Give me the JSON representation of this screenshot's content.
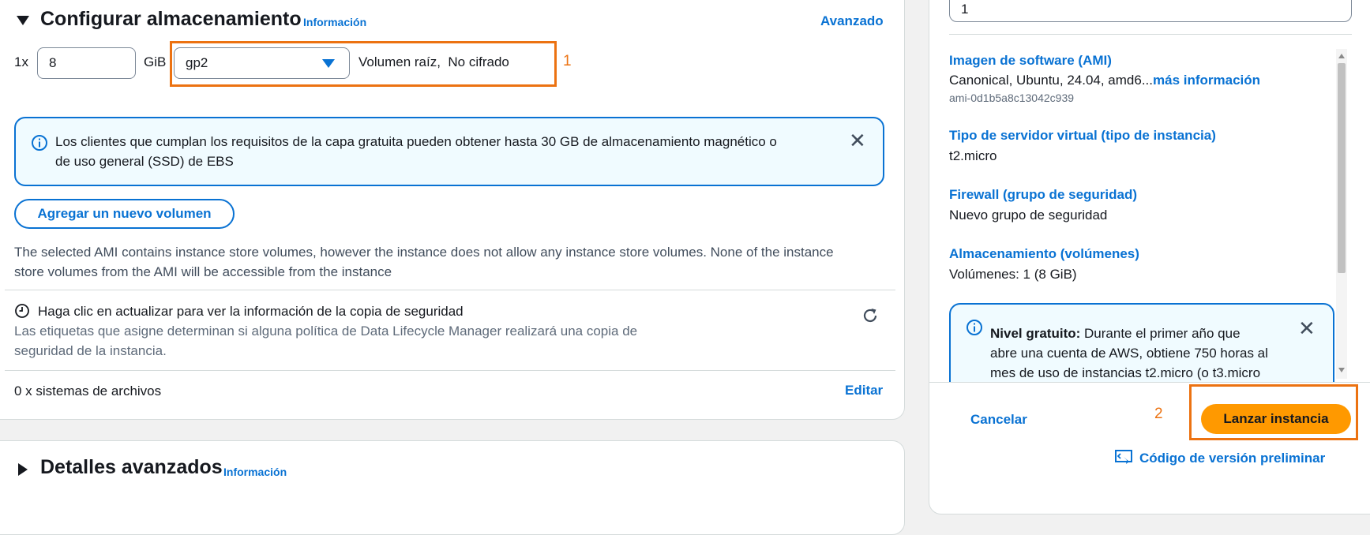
{
  "storage": {
    "title": "Configurar almacenamiento",
    "info_link": "Información",
    "advanced_link": "Avanzado",
    "prefix": "1x",
    "size_value": "8",
    "unit": "GiB",
    "volume_type": "gp2",
    "volume_desc": "Volumen raíz,  No cifrado",
    "marker": "1"
  },
  "free_tier_alert": {
    "line1": "Los clientes que cumplan los requisitos de la capa gratuita pueden obtener hasta 30 GB de almacenamiento magnético o",
    "line2": "de uso general (SSD) de EBS"
  },
  "add_volume_button": "Agregar un nuevo volumen",
  "instance_store_note": {
    "line1": "The selected AMI contains instance store volumes, however the instance does not allow any instance store volumes. None of the instance",
    "line2": "store volumes from the AMI will be accessible from the instance"
  },
  "backup": {
    "title": "Haga clic en actualizar para ver la información de la copia de seguridad",
    "desc_line1": "Las etiquetas que asigne determinan si alguna política de Data Lifecycle Manager realizará una copia de",
    "desc_line2": "seguridad de la instancia."
  },
  "filesystems": {
    "label": "0 x sistemas de archivos",
    "edit": "Editar"
  },
  "advanced_details": {
    "title": "Detalles avanzados",
    "info_link": "Información"
  },
  "summary": {
    "instances_value": "1",
    "ami_label": "Imagen de software (AMI)",
    "ami_value": "Canonical, Ubuntu, 24.04, amd6...",
    "ami_more": "más información",
    "ami_id": "ami-0d1b5a8c13042c939",
    "instance_type_label": "Tipo de servidor virtual (tipo de instancia)",
    "instance_type_value": "t2.micro",
    "firewall_label": "Firewall (grupo de seguridad)",
    "firewall_value": "Nuevo grupo de seguridad",
    "storage_label": "Almacenamiento (volúmenes)",
    "storage_value": "Volúmenes: 1 (8 GiB)",
    "free_tier_bold": "Nivel gratuito:",
    "free_tier_line1": " Durante el primer año que",
    "free_tier_line2": "abre una cuenta de AWS, obtiene 750 horas al",
    "free_tier_line3": "mes de uso de instancias t2.micro (o t3.micro"
  },
  "actions": {
    "cancel": "Cancelar",
    "marker": "2",
    "launch": "Lanzar instancia",
    "preview_code": "Código de versión preliminar"
  },
  "colors": {
    "link": "#0972d3",
    "accent": "#ec7211",
    "launch_button": "#ff9900"
  }
}
